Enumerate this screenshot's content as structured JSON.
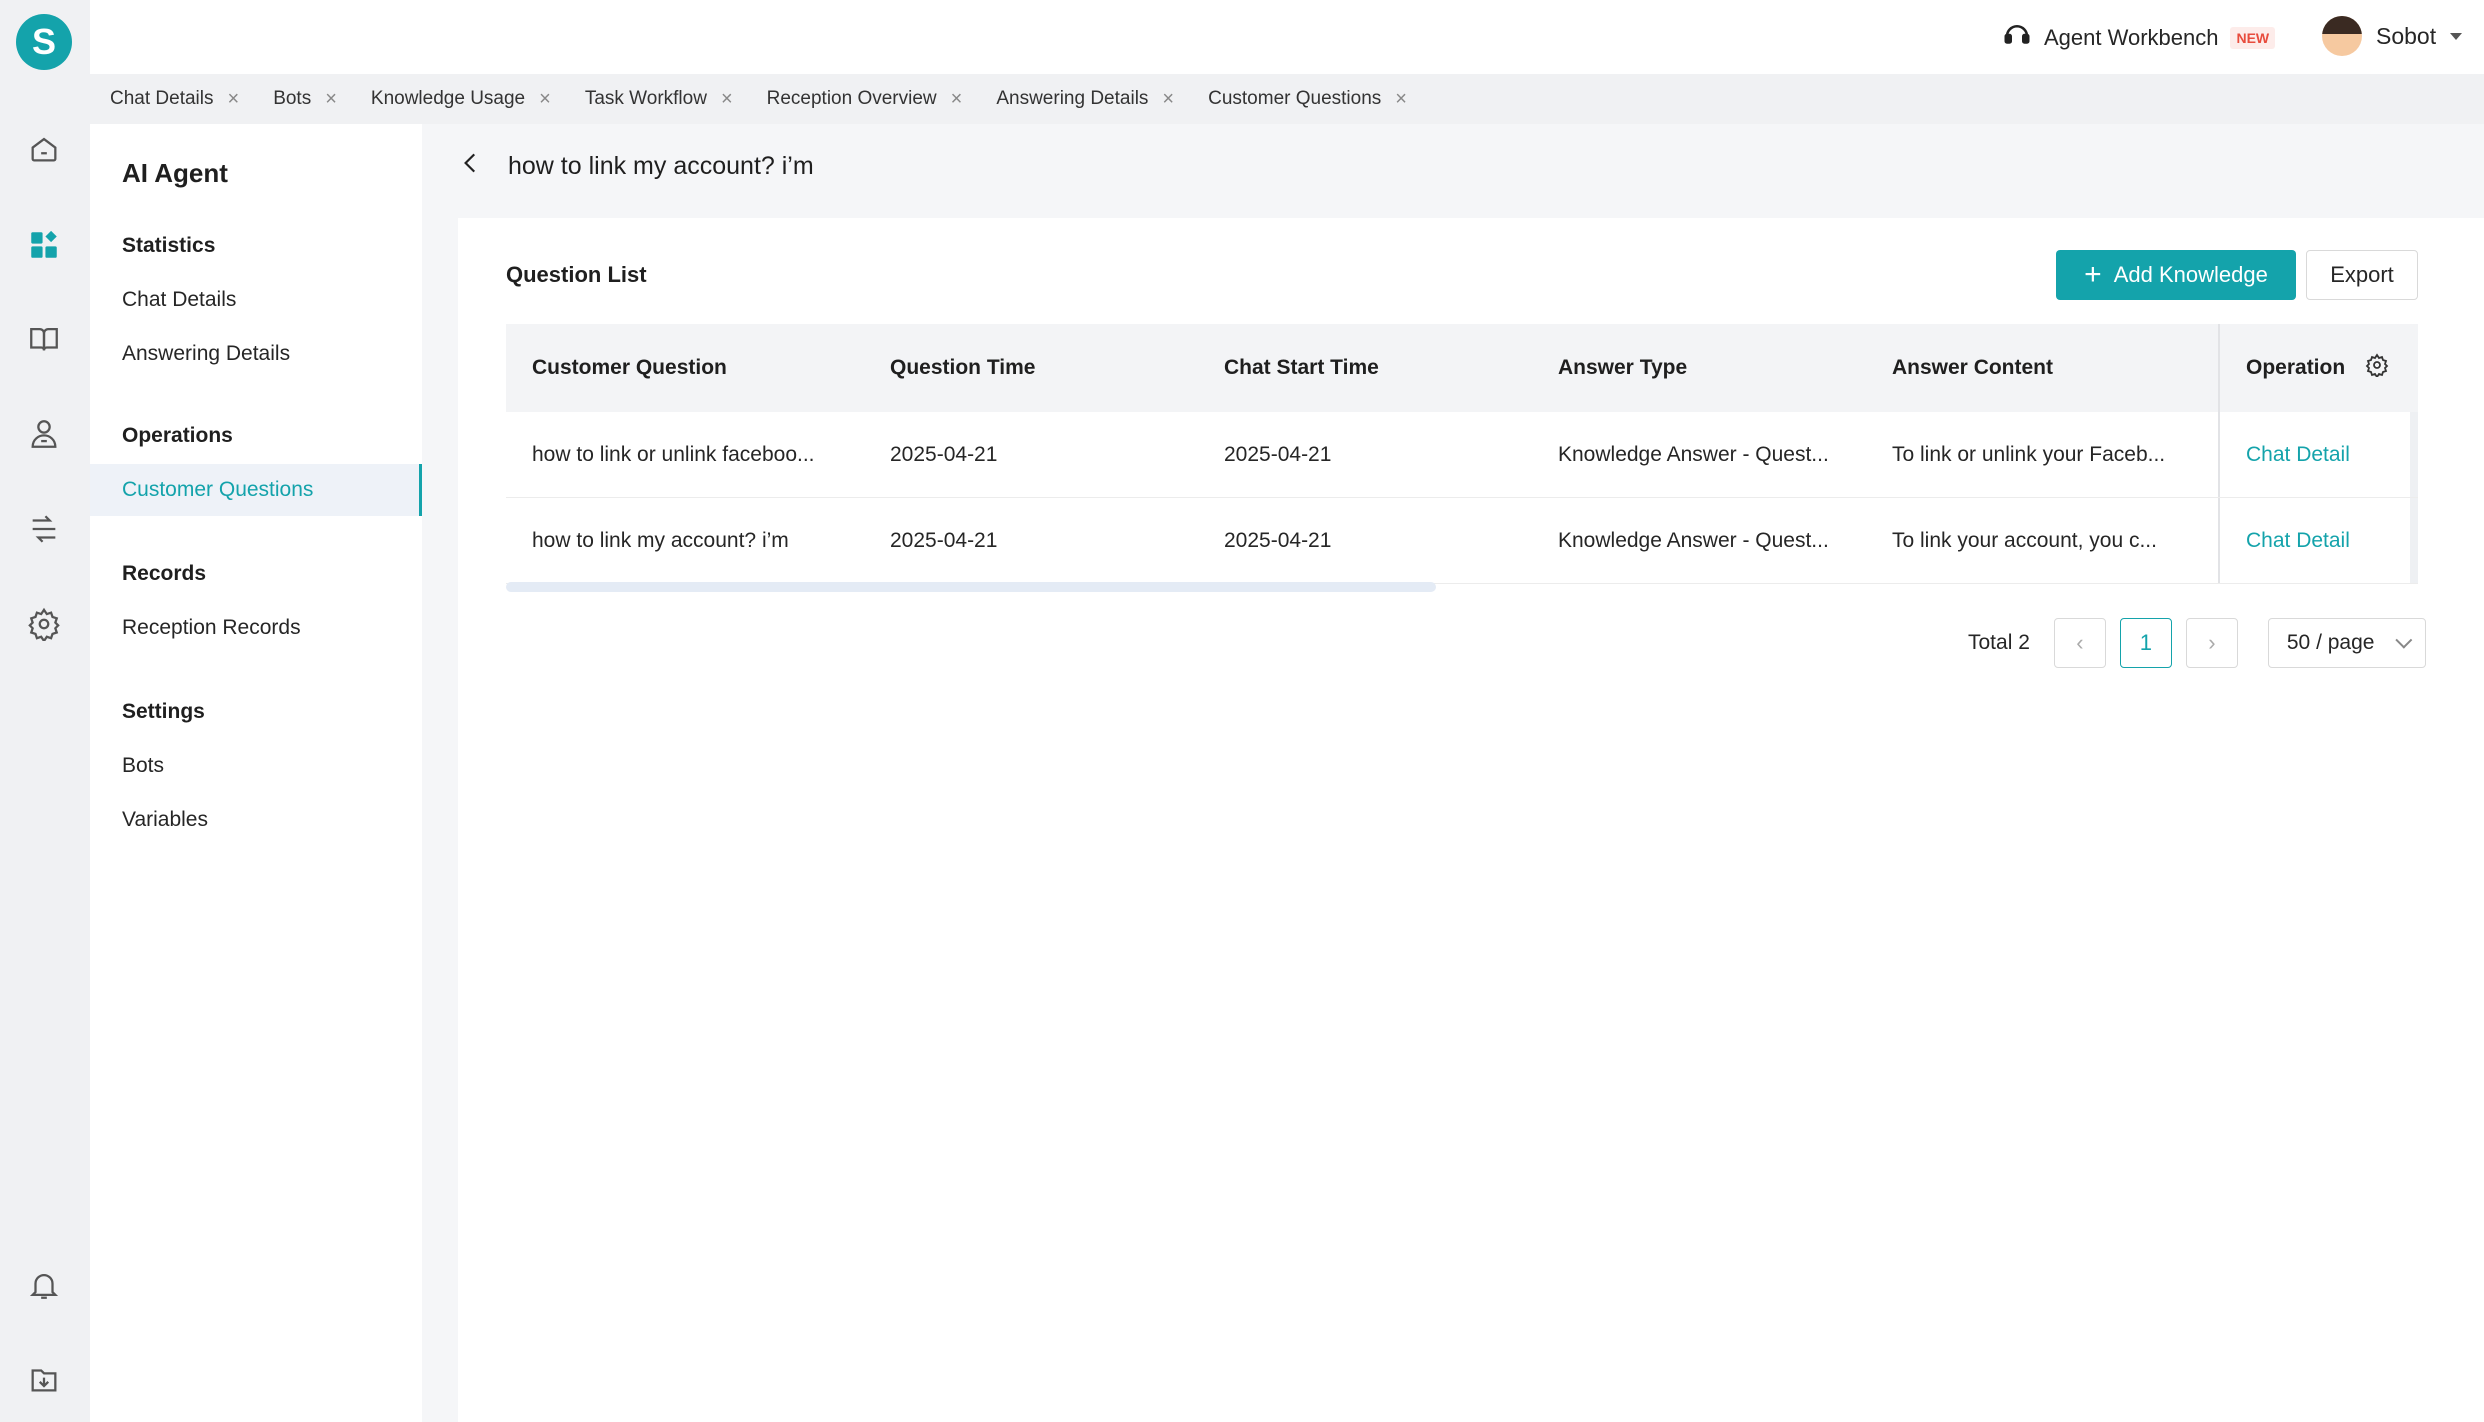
{
  "app": {
    "logo_letter": "S",
    "accent_color": "#14a3ab"
  },
  "rail": {
    "icons": [
      "home-icon",
      "dashboard-icon",
      "book-icon",
      "agent-icon",
      "workflow-icon",
      "settings-icon",
      "bell-icon",
      "download-icon"
    ]
  },
  "topbar": {
    "workbench_label": "Agent Workbench",
    "new_badge": "NEW",
    "user_name": "Sobot"
  },
  "tabs": [
    {
      "label": "Chat Details"
    },
    {
      "label": "Bots"
    },
    {
      "label": "Knowledge Usage"
    },
    {
      "label": "Task Workflow"
    },
    {
      "label": "Reception Overview"
    },
    {
      "label": "Answering Details"
    },
    {
      "label": "Customer Questions"
    }
  ],
  "sidenav": {
    "title": "AI Agent",
    "groups": [
      {
        "title": "Statistics",
        "items": [
          "Chat Details",
          "Answering Details"
        ]
      },
      {
        "title": "Operations",
        "items": [
          "Customer Questions"
        ]
      },
      {
        "title": "Records",
        "items": [
          "Reception Records"
        ]
      },
      {
        "title": "Settings",
        "items": [
          "Bots",
          "Variables"
        ]
      }
    ],
    "active_item": "Customer Questions"
  },
  "page": {
    "title": "how to link my account? i’m"
  },
  "card": {
    "title": "Question List",
    "add_button": "Add Knowledge",
    "export_button": "Export"
  },
  "table": {
    "columns": [
      "Customer Question",
      "Question Time",
      "Chat Start Time",
      "Answer Type",
      "Answer Content",
      "Operation"
    ],
    "rows": [
      {
        "question": "how to link or unlink faceboo...",
        "question_time": "2025-04-21",
        "chat_start_time": "2025-04-21",
        "answer_type": "Knowledge Answer - Quest...",
        "answer_content": "To link or unlink your Faceb...",
        "operation": "Chat Detail"
      },
      {
        "question": "how to link my account? i’m",
        "question_time": "2025-04-21",
        "chat_start_time": "2025-04-21",
        "answer_type": "Knowledge Answer - Quest...",
        "answer_content": "To link your account, you c...",
        "operation": "Chat Detail"
      }
    ]
  },
  "pagination": {
    "total_label": "Total 2",
    "current_page": "1",
    "page_size": "50 / page"
  }
}
